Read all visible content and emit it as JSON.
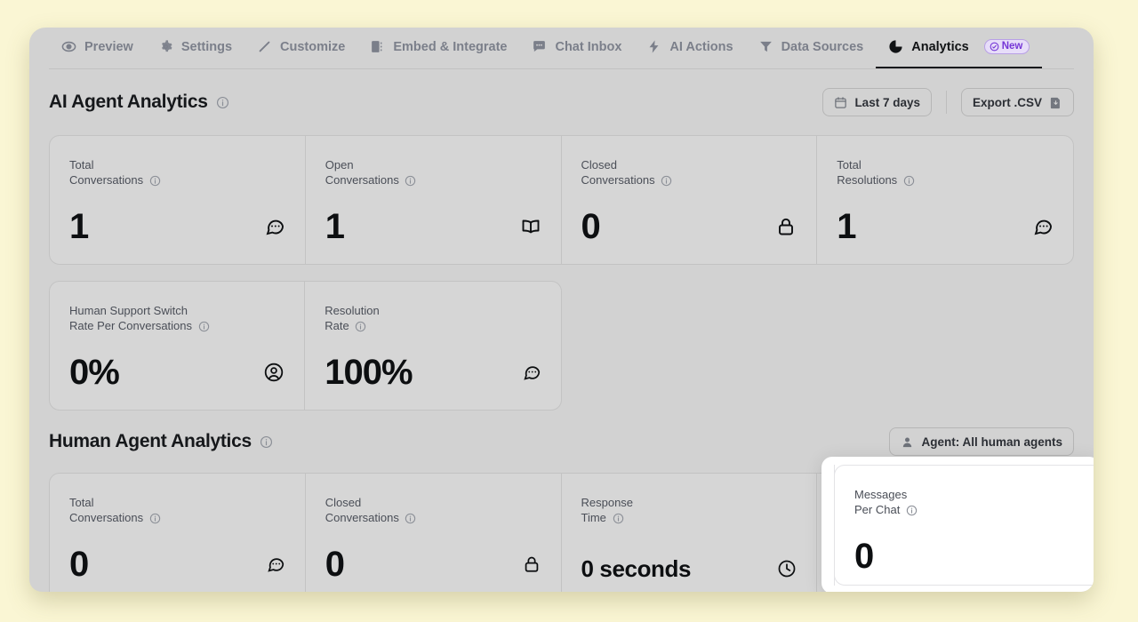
{
  "nav": {
    "items": [
      {
        "label": "Preview",
        "icon": "eye-icon",
        "active": false
      },
      {
        "label": "Settings",
        "icon": "gear-icon",
        "active": false
      },
      {
        "label": "Customize",
        "icon": "pencil-icon",
        "active": false
      },
      {
        "label": "Embed & Integrate",
        "icon": "embed-icon",
        "active": false
      },
      {
        "label": "Chat Inbox",
        "icon": "chat-icon",
        "active": false
      },
      {
        "label": "AI Actions",
        "icon": "bolt-icon",
        "active": false
      },
      {
        "label": "Data Sources",
        "icon": "funnel-icon",
        "active": false
      },
      {
        "label": "Analytics",
        "icon": "pie-chart-icon",
        "active": true
      }
    ],
    "badge": {
      "label": "New",
      "icon": "check-circle-icon",
      "color": "#7536d6"
    }
  },
  "ai_section": {
    "title": "AI Agent Analytics",
    "info_icon": "info-icon",
    "date_filter": {
      "label": "Last 7 days",
      "icon": "calendar-icon"
    },
    "export": {
      "label": "Export .CSV",
      "icon": "download-icon"
    },
    "cards_row1": [
      {
        "label_line1": "Total",
        "label_line2": "Conversations",
        "value": "1",
        "icon": "chat-bubble-dots-icon"
      },
      {
        "label_line1": "Open",
        "label_line2": "Conversations",
        "value": "1",
        "icon": "open-book-icon"
      },
      {
        "label_line1": "Closed",
        "label_line2": "Conversations",
        "value": "0",
        "icon": "lock-icon"
      },
      {
        "label_line1": "Total",
        "label_line2": "Resolutions",
        "value": "1",
        "icon": "chat-bubble-dots-icon"
      }
    ],
    "cards_row2": [
      {
        "label_line1": "Human Support Switch",
        "label_line2": "Rate Per Conversations",
        "value": "0%",
        "icon": "user-circle-icon"
      },
      {
        "label_line1": "Resolution",
        "label_line2": "Rate",
        "value": "100%",
        "icon": "chat-bubble-dots-icon"
      }
    ]
  },
  "human_section": {
    "title": "Human Agent Analytics",
    "info_icon": "info-icon",
    "agent_filter": {
      "label": "Agent: All human agents",
      "icon": "person-icon"
    },
    "cards": [
      {
        "label_line1": "Total",
        "label_line2": "Conversations",
        "value": "0",
        "icon": "chat-bubble-dots-icon"
      },
      {
        "label_line1": "Closed",
        "label_line2": "Conversations",
        "value": "0",
        "icon": "lock-icon"
      },
      {
        "label_line1": "Response",
        "label_line2": "Time",
        "value": "0 seconds",
        "icon": "clock-icon"
      },
      {
        "label_line1": "Messages",
        "label_line2": "Per Chat",
        "value": "0",
        "icon": "inbox-icon"
      }
    ]
  },
  "spotlight": {
    "label_line1": "Messages",
    "label_line2": "Per Chat",
    "value": "0",
    "icon": "inbox-icon"
  },
  "colors": {
    "page_background": "#faf6d4",
    "panel_background": "#d2d2d2",
    "card_background": "#d6d6d6",
    "accent_purple": "#7536d6",
    "text_primary": "#0d0f11",
    "text_muted": "#7b7f8a"
  }
}
